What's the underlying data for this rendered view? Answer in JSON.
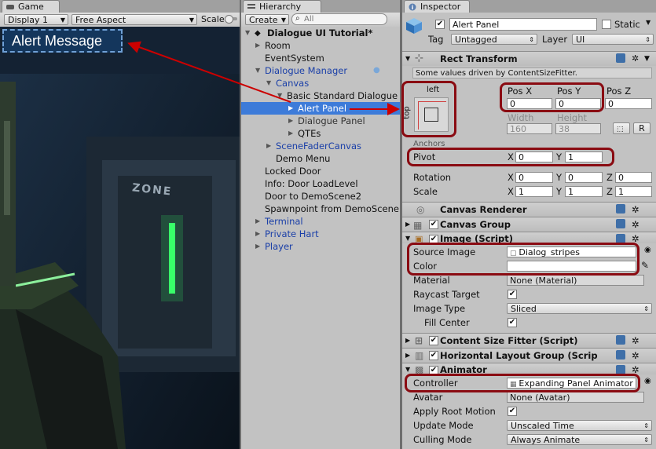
{
  "tabs": {
    "game": "Game",
    "hierarchy": "Hierarchy",
    "inspector": "Inspector"
  },
  "game_toolbar": {
    "display": "Display 1",
    "aspect": "Free Aspect",
    "scale": "Scale"
  },
  "game_view": {
    "alert_text": "Alert Message",
    "zone_sign": "ZONE"
  },
  "hierarchy": {
    "create": "Create",
    "search_placeholder": "All",
    "scene": "Dialogue UI Tutorial*",
    "items": [
      {
        "label": "Room"
      },
      {
        "label": "EventSystem"
      },
      {
        "label": "Dialogue Manager"
      },
      {
        "label": "Canvas"
      },
      {
        "label": "Basic Standard Dialogue"
      },
      {
        "label": "Alert Panel"
      },
      {
        "label": "Dialogue Panel"
      },
      {
        "label": "QTEs"
      },
      {
        "label": "SceneFaderCanvas"
      },
      {
        "label": "Demo Menu"
      },
      {
        "label": "Locked Door"
      },
      {
        "label": "Info: Door LoadLevel"
      },
      {
        "label": "Door to DemoScene2"
      },
      {
        "label": "Spawnpoint from DemoScene"
      },
      {
        "label": "Terminal"
      },
      {
        "label": "Private Hart"
      },
      {
        "label": "Player"
      }
    ]
  },
  "inspector": {
    "object_name": "Alert Panel",
    "static_label": "Static",
    "tag_label": "Tag",
    "tag_value": "Untagged",
    "layer_label": "Layer",
    "layer_value": "UI",
    "rect_transform": {
      "title": "Rect Transform",
      "notice": "Some values driven by ContentSizeFitter.",
      "anchor_h": "left",
      "anchor_v": "top",
      "pos_x_label": "Pos X",
      "pos_x": "0",
      "pos_y_label": "Pos Y",
      "pos_y": "0",
      "pos_z_label": "Pos Z",
      "pos_z": "0",
      "width_label": "Width",
      "width": "160",
      "height_label": "Height",
      "height": "38",
      "r_button": "R",
      "anchors_label": "Anchors",
      "pivot_label": "Pivot",
      "pivot_x": "0",
      "pivot_y": "1",
      "rotation_label": "Rotation",
      "rot_x": "0",
      "rot_y": "0",
      "rot_z": "0",
      "scale_label": "Scale",
      "scale_x": "1",
      "scale_y": "1",
      "scale_z": "1",
      "x": "X",
      "y": "Y",
      "z": "Z"
    },
    "canvas_renderer": "Canvas Renderer",
    "canvas_group": "Canvas Group",
    "image": {
      "title": "Image (Script)",
      "source_label": "Source Image",
      "source_value": "Dialog_stripes",
      "color_label": "Color",
      "material_label": "Material",
      "material_value": "None (Material)",
      "raycast_label": "Raycast Target",
      "type_label": "Image Type",
      "type_value": "Sliced",
      "fill_label": "Fill Center"
    },
    "content_size_fitter": "Content Size Fitter (Script)",
    "horizontal_layout": "Horizontal Layout Group (Scrip",
    "animator": {
      "title": "Animator",
      "controller_label": "Controller",
      "controller_value": "Expanding Panel Animator",
      "avatar_label": "Avatar",
      "avatar_value": "None (Avatar)",
      "root_motion_label": "Apply Root Motion",
      "update_label": "Update Mode",
      "update_value": "Unscaled Time",
      "culling_label": "Culling Mode",
      "culling_value": "Always Animate"
    }
  },
  "colors": {
    "accent_red": "#8a0b12",
    "selection_blue": "#3d7bd9",
    "prefab_blue": "#1a3fa8"
  }
}
